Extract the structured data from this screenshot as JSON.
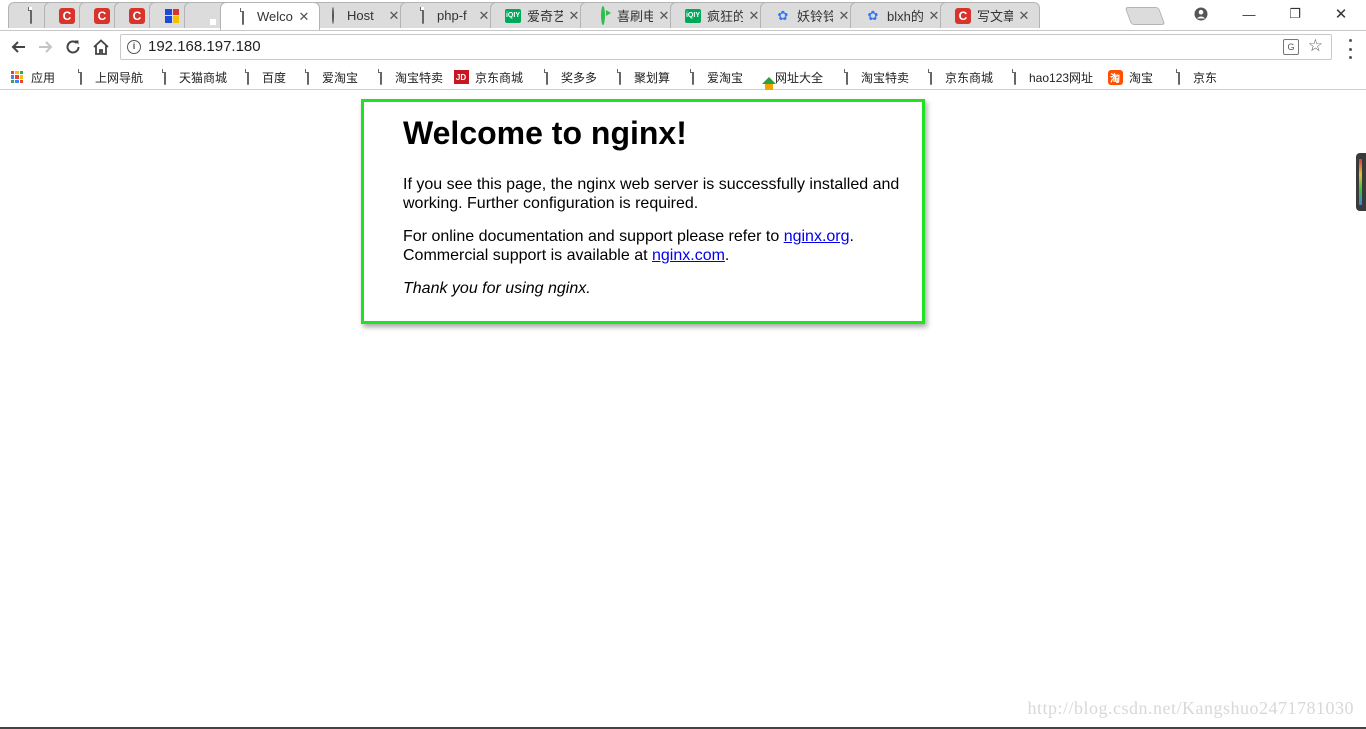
{
  "browser": {
    "tabs": [
      {
        "title": "",
        "icon": "page-icon"
      },
      {
        "title": "",
        "icon": "c-logo-icon"
      },
      {
        "title": "",
        "icon": "c-logo-icon"
      },
      {
        "title": "",
        "icon": "c-logo-icon"
      },
      {
        "title": "",
        "icon": "grid-logo-icon"
      },
      {
        "title": "",
        "icon": "dark-square-icon"
      },
      {
        "title": "Welco",
        "icon": "page-icon",
        "active": true
      },
      {
        "title": "Host",
        "icon": "github-icon"
      },
      {
        "title": "php-f",
        "icon": "page-icon"
      },
      {
        "title": "爱奇艺",
        "icon": "iqiyi-icon"
      },
      {
        "title": "喜刷电",
        "icon": "play-icon"
      },
      {
        "title": "疯狂的",
        "icon": "iqiyi-icon"
      },
      {
        "title": "妖铃铃",
        "icon": "baidu-paw-icon"
      },
      {
        "title": "blxh的",
        "icon": "baidu-paw-icon"
      },
      {
        "title": "写文章",
        "icon": "c-logo-icon"
      }
    ],
    "close_glyph": "✕",
    "window_controls": {
      "minimize": "—",
      "restore": "❐",
      "close": "✕"
    },
    "address": {
      "url": "192.168.197.180"
    },
    "bookmarks": [
      {
        "label": "应用",
        "icon": "apps-icon"
      },
      {
        "label": "上网导航",
        "icon": "page-icon"
      },
      {
        "label": "天猫商城",
        "icon": "page-icon"
      },
      {
        "label": "百度",
        "icon": "page-icon"
      },
      {
        "label": "爱淘宝",
        "icon": "page-icon"
      },
      {
        "label": "淘宝特卖",
        "icon": "page-icon"
      },
      {
        "label": "京东商城",
        "icon": "jd-icon"
      },
      {
        "label": "奖多多",
        "icon": "page-icon"
      },
      {
        "label": "聚划算",
        "icon": "page-icon"
      },
      {
        "label": "爱淘宝",
        "icon": "page-icon"
      },
      {
        "label": "网址大全",
        "icon": "house-icon"
      },
      {
        "label": "淘宝特卖",
        "icon": "page-icon"
      },
      {
        "label": "京东商城",
        "icon": "page-icon"
      },
      {
        "label": "hao123网址",
        "icon": "page-icon"
      },
      {
        "label": "淘宝",
        "icon": "taobao-icon"
      },
      {
        "label": "京东",
        "icon": "page-icon"
      }
    ]
  },
  "content": {
    "heading": "Welcome to nginx!",
    "para1": "If you see this page, the nginx web server is successfully installed and working. Further configuration is required.",
    "para2_pre": "For online documentation and support please refer to ",
    "link_org": "nginx.org",
    "para2_mid": ".",
    "para2_line2": "Commercial support is available at ",
    "link_com": "nginx.com",
    "para2_end": ".",
    "thanks": "Thank you for using nginx."
  },
  "watermark": "http://blog.csdn.net/Kangshuo2471781030",
  "colors": {
    "highlight_border": "#22e022",
    "link": "#0000ee"
  }
}
